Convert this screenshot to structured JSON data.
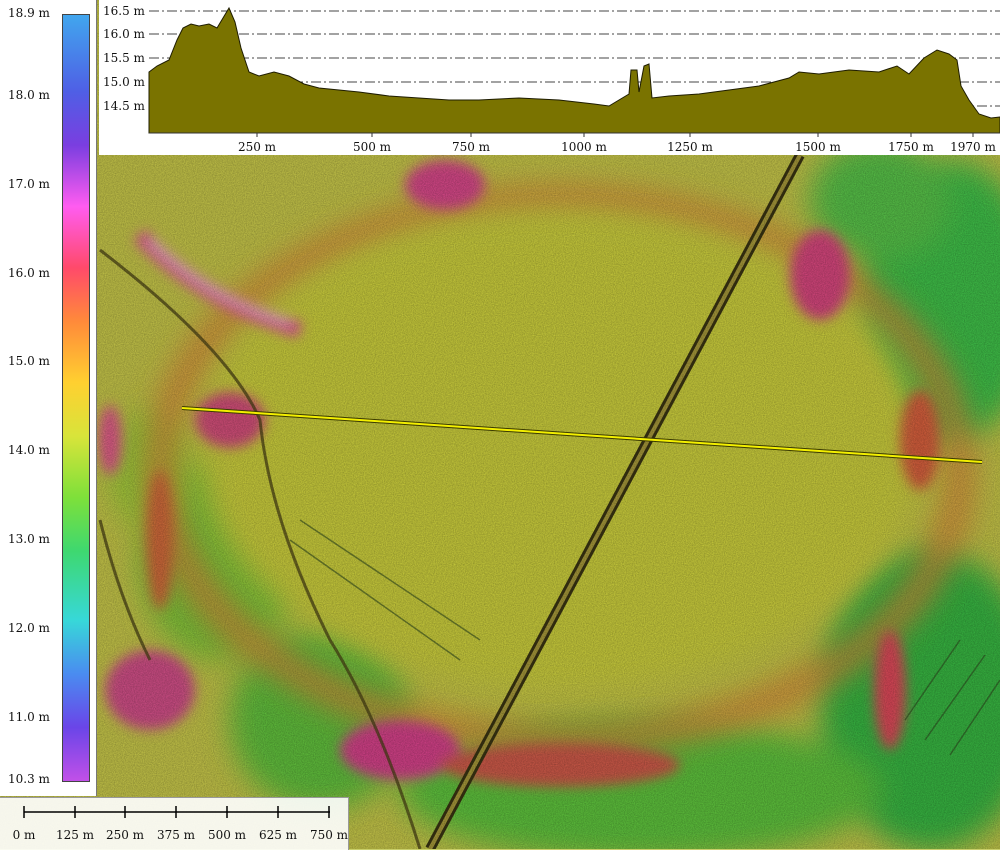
{
  "legend": {
    "labels": [
      "18.9 m",
      "18.0 m",
      "17.0 m",
      "16.0 m",
      "15.0 m",
      "14.0 m",
      "13.0 m",
      "12.0 m",
      "11.0 m",
      "10.3 m"
    ]
  },
  "profile": {
    "y_labels": [
      "16.5 m",
      "16.0 m",
      "15.5 m",
      "15.0 m",
      "14.5 m"
    ],
    "x_labels": [
      "250 m",
      "500 m",
      "750 m",
      "1000 m",
      "1250 m",
      "1500 m",
      "1750 m",
      "1970 m"
    ],
    "fill_color": "#7a7300"
  },
  "scale_bar": {
    "labels": [
      "0 m",
      "125 m",
      "250 m",
      "375 m",
      "500 m",
      "625 m",
      "750 m"
    ]
  },
  "map": {
    "profile_line_color": "#f4f000",
    "palette": {
      "low": "#3fbf4a",
      "mid": "#c9cf3a",
      "high": "#ff4f9a",
      "ridge": "#e0507a"
    }
  }
}
